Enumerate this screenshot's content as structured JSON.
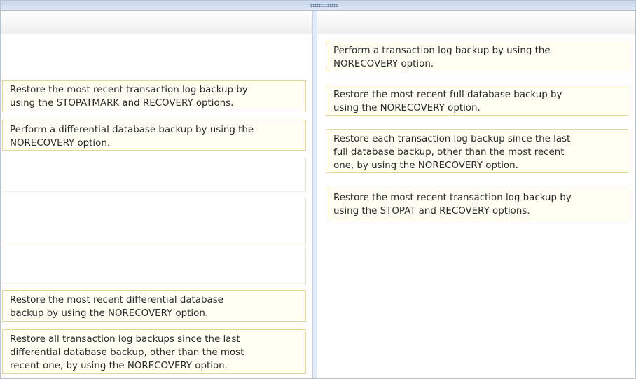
{
  "left_items": [
    {
      "lines": [
        "Restore the most recent transaction log backup by",
        "using the STOPATMARK and RECOVERY options."
      ]
    },
    {
      "lines": [
        "Perform a differential database backup by using the",
        "NORECOVERY option."
      ]
    },
    {
      "lines": [
        "Restore the most recent differential database",
        "backup by using the NORECOVERY option."
      ]
    },
    {
      "lines": [
        "Restore all transaction log backups since the last",
        "differential database backup, other than the most",
        "recent one, by using the NORECOVERY option."
      ]
    }
  ],
  "right_items": [
    {
      "lines": [
        "Perform a transaction log backup by using the",
        "NORECOVERY option."
      ]
    },
    {
      "lines": [
        "Restore the most recent full database backup by",
        "using the NORECOVERY option."
      ]
    },
    {
      "lines": [
        "Restore each transaction log backup since the last",
        "full database backup, other than the most recent",
        "one, by using the NORECOVERY option."
      ]
    },
    {
      "lines": [
        "Restore the most recent transaction log backup by",
        "using the STOPAT and RECOVERY options."
      ]
    }
  ]
}
